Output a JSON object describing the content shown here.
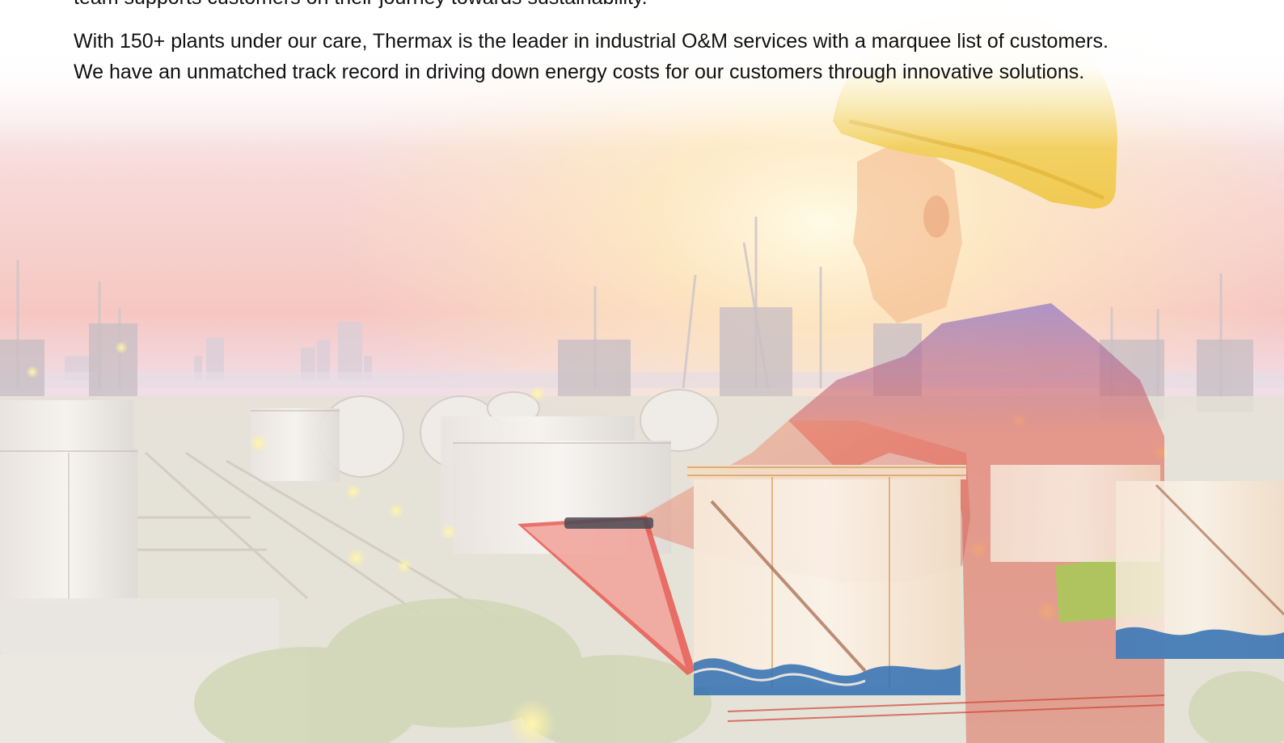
{
  "content": {
    "para_top": "team supports customers on their journey towards sustainability.",
    "para_main_line1": "With 150+ plants under our care, Thermax is the leader in industrial O&M services with a marquee list of customers.",
    "para_main_line2": "We have an unmatched track record in driving down energy costs for our customers through innovative solutions."
  },
  "hero_image": {
    "subject": "engineer-in-hard-hat-over-refinery-at-sunset",
    "colors": {
      "sky_warm": "#f6c7c2",
      "sun_glow": "#fff4c9",
      "haze": "#f3e9ee",
      "tank_white": "#f4f0ec",
      "helmet_yellow": "#f3cf57",
      "shirt_purple": "#8c77c9",
      "shirt_red": "#e35a4b",
      "vest_green": "#9ed24f",
      "tank_blue": "#2f6fb2"
    }
  }
}
